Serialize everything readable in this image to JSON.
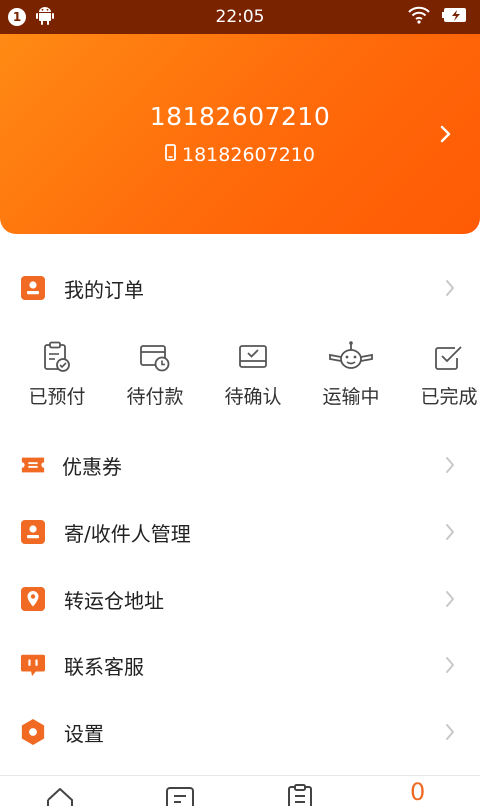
{
  "status_bar": {
    "notification_count": "1",
    "time": "22:05"
  },
  "profile": {
    "name": "18182607210",
    "phone": "18182607210"
  },
  "orders": {
    "title": "我的订单",
    "statuses": [
      {
        "label": "已预付",
        "icon": "clipboard-check-icon"
      },
      {
        "label": "待付款",
        "icon": "card-clock-icon"
      },
      {
        "label": "待确认",
        "icon": "tray-check-icon"
      },
      {
        "label": "运输中",
        "icon": "airplane-icon"
      },
      {
        "label": "已完成",
        "icon": "checkbox-icon"
      }
    ]
  },
  "menu": {
    "coupons": "优惠券",
    "contacts": "寄/收件人管理",
    "warehouse": "转运仓地址",
    "support": "联系客服",
    "settings": "设置"
  },
  "bottom_nav": {
    "active_glyph": "0"
  },
  "colors": {
    "accent": "#ff6a0a",
    "status_bar": "#7a2300",
    "icon_orange": "#f06a23"
  }
}
